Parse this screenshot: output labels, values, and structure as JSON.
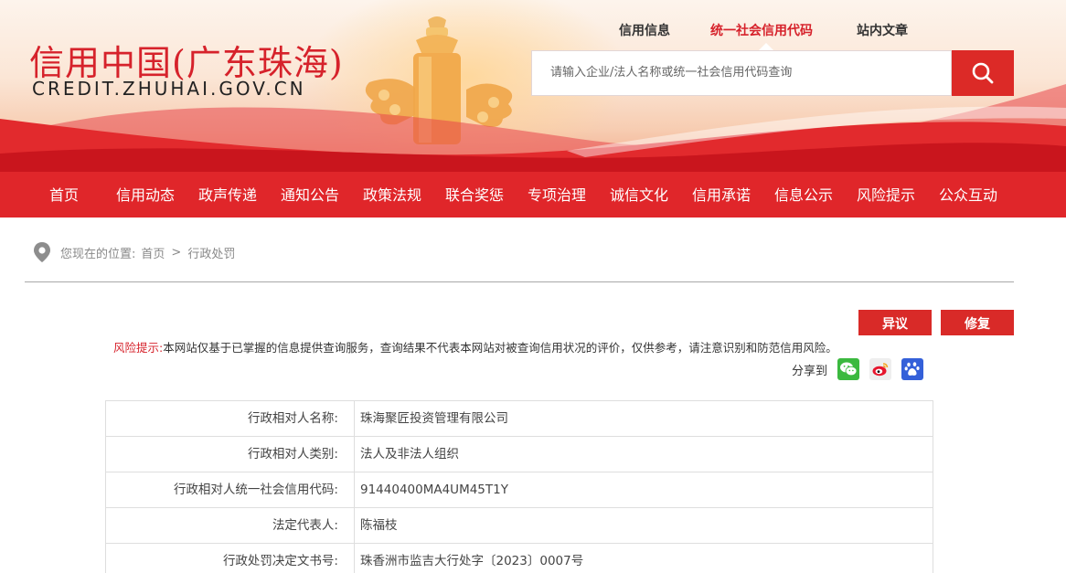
{
  "header": {
    "site_title": "信用中国(广东珠海)",
    "site_domain": "CREDIT.ZHUHAI.GOV.CN",
    "search_tabs": [
      {
        "label": "信用信息",
        "active": false
      },
      {
        "label": "统一社会信用代码",
        "active": true
      },
      {
        "label": "站内文章",
        "active": false
      }
    ],
    "search_placeholder": "请输入企业/法人名称或统一社会信用代码查询",
    "search_icon": "search-icon"
  },
  "nav": {
    "items": [
      "首页",
      "信用动态",
      "政声传递",
      "通知公告",
      "政策法规",
      "联合奖惩",
      "专项治理",
      "诚信文化",
      "信用承诺",
      "信息公示",
      "风险提示",
      "公众互动"
    ]
  },
  "breadcrumb": {
    "prefix": "您现在的位置:",
    "items": [
      "首页",
      "行政处罚"
    ],
    "separator": ">"
  },
  "actions": {
    "objection_label": "异议",
    "repair_label": "修复"
  },
  "risk_notice": {
    "label": "风险提示:",
    "text": "本网站仅基于已掌握的信息提供查询服务，查询结果不代表本网站对被查询信用状况的评价，仅供参考，请注意识别和防范信用风险。"
  },
  "share": {
    "label": "分享到",
    "targets": [
      "wechat-icon",
      "weibo-icon",
      "baidu-icon"
    ]
  },
  "record": {
    "rows": [
      {
        "label": "行政相对人名称:",
        "value": "珠海聚匠投资管理有限公司"
      },
      {
        "label": "行政相对人类别:",
        "value": "法人及非法人组织"
      },
      {
        "label": "行政相对人统一社会信用代码:",
        "value": "91440400MA4UM45T1Y"
      },
      {
        "label": "法定代表人:",
        "value": "陈福枝"
      },
      {
        "label": "行政处罚决定文书号:",
        "value": "珠香洲市监吉大行处字〔2023〕0007号"
      }
    ]
  },
  "colors": {
    "brand_red": "#e0262a",
    "title_red": "#d6222b",
    "wechat_green": "#3bb93f",
    "baidu_blue": "#3460d9"
  }
}
